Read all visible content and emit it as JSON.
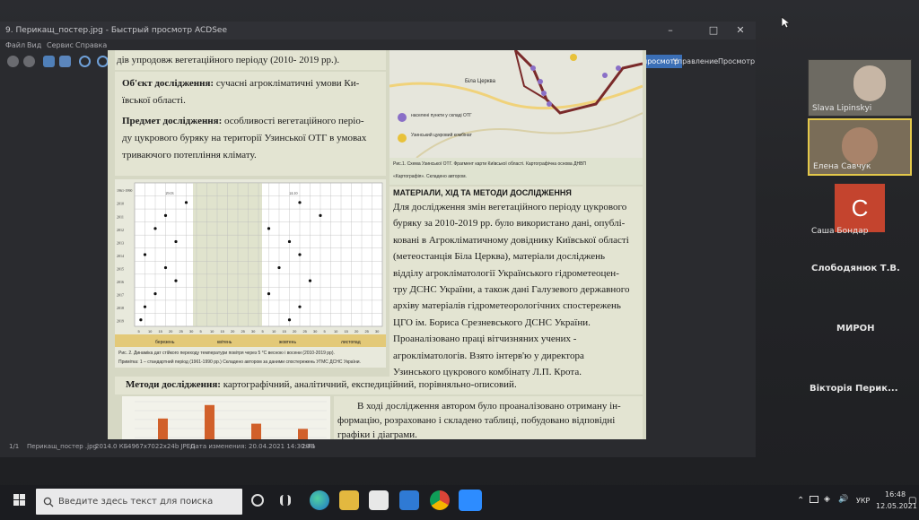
{
  "viewer": {
    "title": "9. Перикащ_постер.jpg - Быстрый просмотр ACDSee",
    "menu": [
      "Файл",
      "Вид",
      "Сервис",
      "Справка"
    ],
    "tabs": [
      "Быстрый просмотр",
      "Управление",
      "Просмотр"
    ],
    "status": {
      "position": "1/1",
      "filename": "Перикащ_постер .jpg",
      "filesize": "2014.0 КБ",
      "dimensions": "4967x7022x24b JPEG",
      "modified": "Дата изменения: 20.04.2021 14:30:40",
      "zoom": "20%"
    }
  },
  "poster": {
    "top_line": "дів упродовж вегетаційного періоду (2010- 2019 рр.).",
    "object_label": "Об'єкт дослідження:",
    "object_text_1": "сучасні агрокліматичні умови Ки-",
    "object_text_2": "ївської області.",
    "subject_label": "Предмет дослідження:",
    "subject_text_1": "особливості вегетаційного періо-",
    "subject_text_2": "ду цукрового буряку на території Узинської ОТГ в умовах",
    "subject_text_3": "триваючого потепління клімату.",
    "map_legend_1": "населені пункти у складі ОТГ",
    "map_legend_2": "Узинський цукровий комбінат",
    "map_town": "Біла Церква",
    "map_caption_1": "Рис.1. Схема Узинської ОТГ. Фрагмент карти Київської області. Картографічна основа ДНВП",
    "map_caption_2": "«Картографія». Складено автором.",
    "chart_caption_1": "Рис. 2. Динаміка дат стійкого переходу температури повітря через 5 °С весною і восени (2010-2019 рр).",
    "chart_caption_2": "Примітка: 1 – стандартний період (1961-1990 рр.) Складено автором за даними спостережень УГМС ДСНС України.",
    "methods_heading": "МАТЕРІАЛИ, ХІД ТА МЕТОДИ ДОСЛІДЖЕННЯ",
    "methods_lines": [
      "Для дослідження змін вегетаційного періоду цукрового",
      "буряку за 2010-2019 рр. було використано дані, опублі-",
      "ковані в Агрокліматичному довіднику Київської області",
      "(метеостанція Біла Церква), матеріали досліджень",
      "відділу агрокліматології  Українського гідрометеоцен-",
      "тру ДСНС України, а також дані Галузевого державного",
      "архіву матеріалів гідрометеорологічних спостережень",
      "ЦГО ім. Бориса Срезневського ДСНС України.",
      "Проаналізовано праці вітчизняних учених -",
      "агрокліматологів. Взято інтерв'ю у директора",
      "Узинського цукрового комбінату Л.П. Крота."
    ],
    "research_methods_label": "Методи дослідження:",
    "research_methods_text": "картографічний, аналітичний, експедиційний, порівняльно-описовий.",
    "results_lines": [
      "В ході дослідження автором було проаналізовано отриману ін-",
      "формацію, розраховано і складено таблиці, побудовано відповідні",
      "графіки і діаграми."
    ]
  },
  "chart_data": [
    {
      "type": "scatter",
      "title": "",
      "categories": [
        "1961-1990",
        "2010",
        "2011",
        "2012",
        "2013",
        "2014",
        "2015",
        "2016",
        "2017",
        "2018",
        "2019"
      ],
      "x_tick_labels": [
        "5",
        "10",
        "15",
        "20",
        "25",
        "30",
        "5",
        "10",
        "15",
        "20",
        "25",
        "30",
        "5",
        "10",
        "15",
        "20",
        "25",
        "30",
        "5",
        "10",
        "15",
        "20",
        "25",
        "30"
      ],
      "months": [
        "березень",
        "квітень",
        "жовтень",
        "листопад"
      ],
      "series": [
        {
          "values": [
            null,
            25,
            15,
            10,
            20,
            5,
            15,
            20,
            10,
            5,
            3
          ]
        },
        {
          "values": [
            null,
            20,
            30,
            5,
            15,
            20,
            10,
            25,
            5,
            20,
            15
          ]
        }
      ],
      "legend_values": [
        "29.03",
        "24.10"
      ]
    },
    {
      "type": "bar",
      "values": [
        54,
        80,
        44,
        34
      ]
    }
  ],
  "participants": [
    {
      "name": "Slava Lipinskyi"
    },
    {
      "name": "Елена Савчук"
    },
    {
      "name": "Саша Бондар",
      "initial": "C"
    },
    {
      "name": "Слободянюк Т.В."
    },
    {
      "name": "МИРОН"
    },
    {
      "name": "Вікторія Перик..."
    }
  ],
  "taskbar": {
    "search_placeholder": "Введите здесь текст для поиска",
    "language": "УКР",
    "time": "16:48",
    "date": "12.05.2021"
  },
  "colors": {
    "poster_background": "#e3e4d2",
    "chart_bars": "#d1602a",
    "map_border": "#7a2a2a",
    "zoom_avatar_red": "#c4442e",
    "viewer_tab_blue": "#3b6fb6"
  }
}
